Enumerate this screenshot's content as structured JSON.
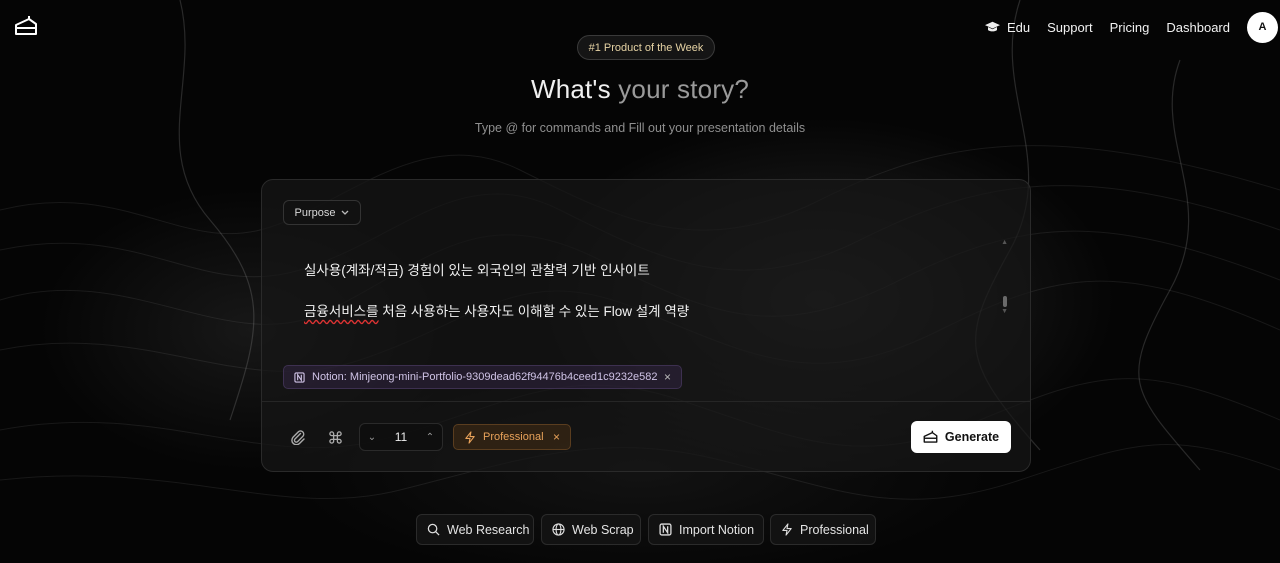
{
  "header": {
    "nav": [
      {
        "label": "Edu",
        "icon": "graduation-cap-icon"
      },
      {
        "label": "Support"
      },
      {
        "label": "Pricing"
      },
      {
        "label": "Dashboard"
      }
    ],
    "avatar_initial": "A"
  },
  "hero": {
    "badge": "#1 Product of the Week",
    "title_main": "What's ",
    "title_dim": "your story?",
    "subtitle": "Type @ for commands and Fill out your presentation details"
  },
  "composer": {
    "purpose_label": "Purpose",
    "prompt_lines": [
      "실사용(계좌/적금) 경험이 있는 외국인의 관찰력 기반 인사이트",
      "금융서비스를 처음 사용하는 사용자도 이해할 수 있는 Flow 설계 역량"
    ],
    "prompt_line2_misspelled": "금융서비스를",
    "prompt_line2_rest": " 처음 사용하는 사용자도 이해할 수 있는 Flow 설계 역량",
    "notion_chip": "Notion: Minjeong-mini-Portfolio-9309dead62f94476b4ceed1c9232e582",
    "slide_count": "11",
    "style_chip": "Professional",
    "generate_label": "Generate"
  },
  "quick_actions": [
    {
      "label": "Web Research",
      "icon": "search-icon"
    },
    {
      "label": "Web Scrap",
      "icon": "globe-icon"
    },
    {
      "label": "Import Notion",
      "icon": "notion-icon"
    },
    {
      "label": "Professional",
      "icon": "lightning-icon"
    }
  ],
  "colors": {
    "background": "#050505",
    "accent_orange": "#e8a25a",
    "notion_chip_text": "#cfc3e6",
    "badge_text": "#e6d3a4"
  }
}
